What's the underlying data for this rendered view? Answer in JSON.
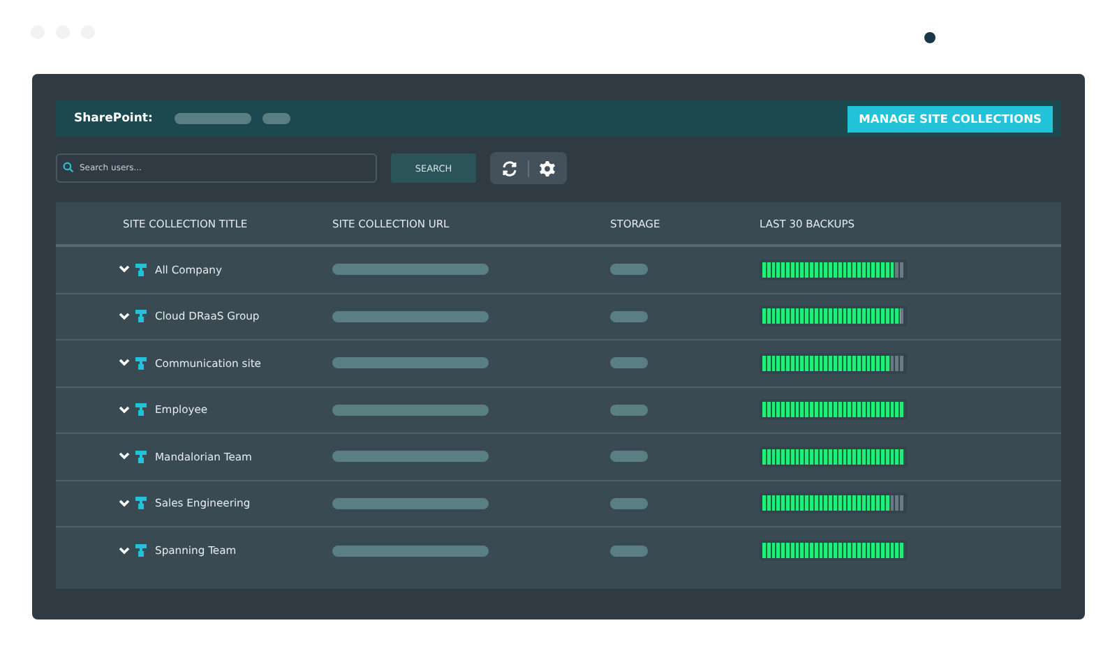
{
  "header": {
    "label": "SharePoint:",
    "action": "MANAGE SITE COLLECTIONS"
  },
  "search": {
    "placeholder": "Search users...",
    "button": "SEARCH"
  },
  "table": {
    "columns": [
      "SITE COLLECTION TITLE",
      "SITE COLLECTION URL",
      "STORAGE",
      "LAST 30 BACKUPS"
    ],
    "rows": [
      {
        "title": "All Company",
        "expanded": false,
        "level": 0.9333
      },
      {
        "title": "Cloud DRaaS Group",
        "expanded": false,
        "level": 0.9667
      },
      {
        "title": "Communication site",
        "expanded": false,
        "level": 0.9
      },
      {
        "title": "Employee",
        "expanded": false,
        "level": 1
      },
      {
        "title": "Mandalorian Team",
        "expanded": false,
        "level": 1
      },
      {
        "title": "Sales Engineering",
        "expanded": false,
        "level": 0.9
      },
      {
        "title": "Spanning Team",
        "expanded": false,
        "level": 1
      }
    ]
  }
}
